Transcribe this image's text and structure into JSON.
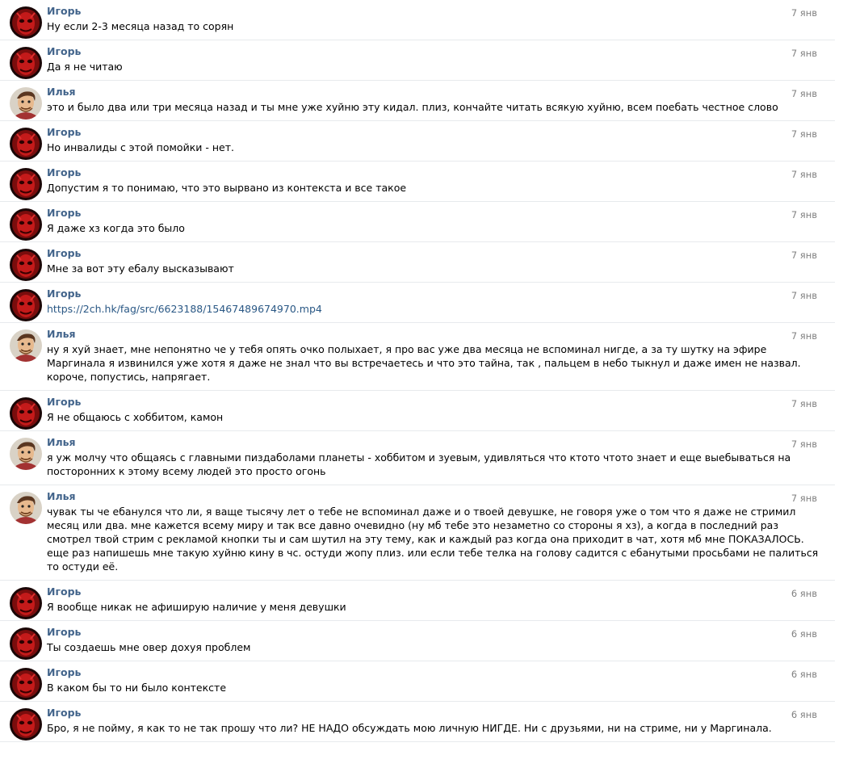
{
  "colors": {
    "author_name": "#42648b",
    "date": "#828282",
    "link": "#2a5885",
    "divider": "#e7eaed"
  },
  "avatars": {
    "igor": "red-mask-avatar",
    "ilya": "cartoon-face-avatar"
  },
  "messages": [
    {
      "author": "Игорь",
      "avatar": "igor",
      "date": "7 янв",
      "text": "Ну если 2-3 месяца назад то сорян"
    },
    {
      "author": "Игорь",
      "avatar": "igor",
      "date": "7 янв",
      "text": "Да я не читаю"
    },
    {
      "author": "Илья",
      "avatar": "ilya",
      "date": "7 янв",
      "text": "это и было два или три месяца назад и ты мне уже хуйню эту кидал. плиз, кончайте читать всякую хуйню, всем поебать честное слово"
    },
    {
      "author": "Игорь",
      "avatar": "igor",
      "date": "7 янв",
      "text": "Но инвалиды с этой помойки - нет."
    },
    {
      "author": "Игорь",
      "avatar": "igor",
      "date": "7 янв",
      "text": "Допустим я то понимаю, что это вырвано из контекста и все такое"
    },
    {
      "author": "Игорь",
      "avatar": "igor",
      "date": "7 янв",
      "text": "Я даже хз когда это было"
    },
    {
      "author": "Игорь",
      "avatar": "igor",
      "date": "7 янв",
      "text": "Мне за вот эту ебалу высказывают"
    },
    {
      "author": "Игорь",
      "avatar": "igor",
      "date": "7 янв",
      "text": "https://2ch.hk/fag/src/6623188/15467489674970.mp4",
      "is_link": true
    },
    {
      "author": "Илья",
      "avatar": "ilya",
      "date": "7 янв",
      "text": "ну я хуй знает, мне непонятно че у тебя опять очко полыхает, я про вас уже два месяца не вспоминал нигде, а за ту шутку на эфире Маргинала я извинился уже хотя я даже не знал что вы встречаетесь и что это тайна, так , пальцем в небо тыкнул и даже имен не назвал. короче, попустись, напрягает."
    },
    {
      "author": "Игорь",
      "avatar": "igor",
      "date": "7 янв",
      "text": "Я не общаюсь с хоббитом, камон"
    },
    {
      "author": "Илья",
      "avatar": "ilya",
      "date": "7 янв",
      "text": "я уж молчу что общаясь с главными пиздаболами планеты - хоббитом и зуевым, удивляться что ктото чтото знает и еще выебываться на посторонних к этому всему людей это просто огонь"
    },
    {
      "author": "Илья",
      "avatar": "ilya",
      "date": "7 янв",
      "text": "чувак ты че ебанулся что ли, я ваще тысячу лет о тебе не вспоминал даже и о твоей девушке, не говоря уже о том что я даже не стримил месяц или два. мне кажется всему миру и так все давно очевидно (ну мб тебе это незаметно со стороны я хз), а когда в последний раз смотрел твой стрим с рекламой кнопки ты и сам шутил на эту тему, как и каждый раз когда она приходит в чат, хотя мб мне ПОКАЗАЛОСЬ. еще раз напишешь мне такую хуйню кину в чс. остуди жопу плиз. или если тебе телка на голову садится с ебанутыми просьбами не палиться то остуди её."
    },
    {
      "author": "Игорь",
      "avatar": "igor",
      "date": "6 янв",
      "text": "Я вообще никак не афиширую наличие у меня девушки"
    },
    {
      "author": "Игорь",
      "avatar": "igor",
      "date": "6 янв",
      "text": "Ты создаешь мне овер дохуя проблем"
    },
    {
      "author": "Игорь",
      "avatar": "igor",
      "date": "6 янв",
      "text": "В каком бы то ни было контексте"
    },
    {
      "author": "Игорь",
      "avatar": "igor",
      "date": "6 янв",
      "text": "Бро, я не пойму, я как то не так прошу что ли? НЕ НАДО обсуждать мою личную НИГДЕ. Ни с друзьями, ни на стриме, ни у Маргинала."
    }
  ]
}
